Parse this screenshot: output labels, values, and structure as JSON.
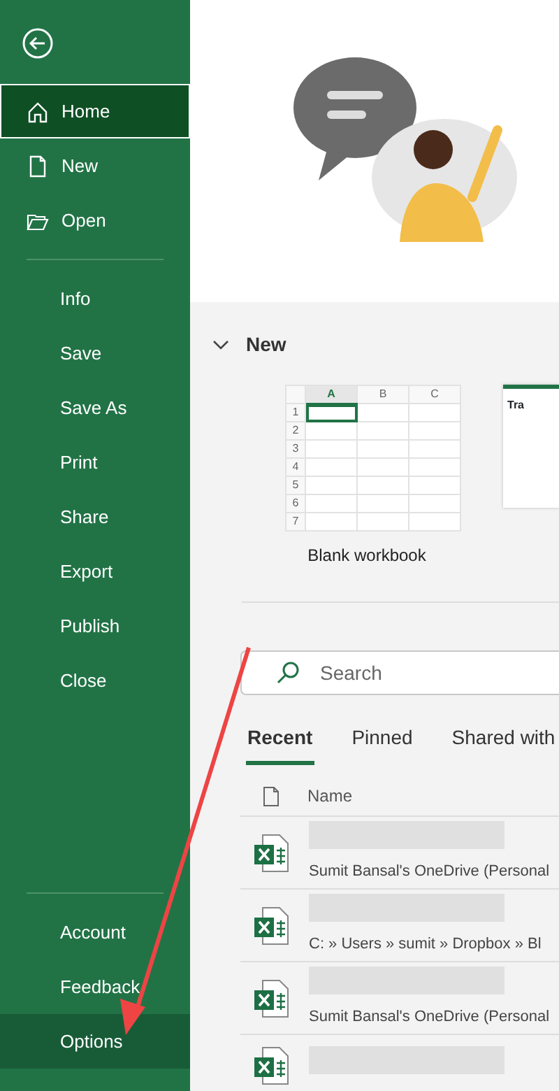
{
  "sidebar": {
    "groups": [
      {
        "items": [
          {
            "label": "Home",
            "selected": true,
            "hovered": false
          },
          {
            "label": "New",
            "selected": false,
            "hovered": false
          },
          {
            "label": "Open",
            "selected": false,
            "hovered": false
          }
        ]
      },
      {
        "items": [
          {
            "label": "Info",
            "selected": false,
            "hovered": false
          },
          {
            "label": "Save",
            "selected": false,
            "hovered": false
          },
          {
            "label": "Save As",
            "selected": false,
            "hovered": false
          },
          {
            "label": "Print",
            "selected": false,
            "hovered": false
          },
          {
            "label": "Share",
            "selected": false,
            "hovered": false
          },
          {
            "label": "Export",
            "selected": false,
            "hovered": false
          },
          {
            "label": "Publish",
            "selected": false,
            "hovered": false
          },
          {
            "label": "Close",
            "selected": false,
            "hovered": false
          }
        ]
      },
      {
        "items": [
          {
            "label": "Account",
            "selected": false,
            "hovered": false
          },
          {
            "label": "Feedback",
            "selected": false,
            "hovered": false
          },
          {
            "label": "Options",
            "selected": false,
            "hovered": true
          }
        ]
      }
    ]
  },
  "new_section": {
    "title": "New",
    "expanded": true,
    "blank_workbook": {
      "label": "Blank workbook",
      "columns": [
        "A",
        "B",
        "C"
      ],
      "rows": [
        "1",
        "2",
        "3",
        "4",
        "5",
        "6",
        "7"
      ]
    },
    "template": {
      "title": "Tra"
    }
  },
  "search": {
    "placeholder": "Search"
  },
  "tabs": [
    {
      "label": "Recent",
      "selected": true
    },
    {
      "label": "Pinned",
      "selected": false
    },
    {
      "label": "Shared with",
      "selected": false
    }
  ],
  "files": {
    "columns": [
      "Name"
    ],
    "rows": [
      {
        "location": "Sumit Bansal's OneDrive (Personal"
      },
      {
        "location": "C: » Users » sumit » Dropbox » Bl"
      },
      {
        "location": "Sumit Bansal's OneDrive (Personal"
      },
      {
        "kind": "partial"
      }
    ]
  },
  "annotation": {
    "kind": "arrow",
    "color": "#ee4444"
  }
}
